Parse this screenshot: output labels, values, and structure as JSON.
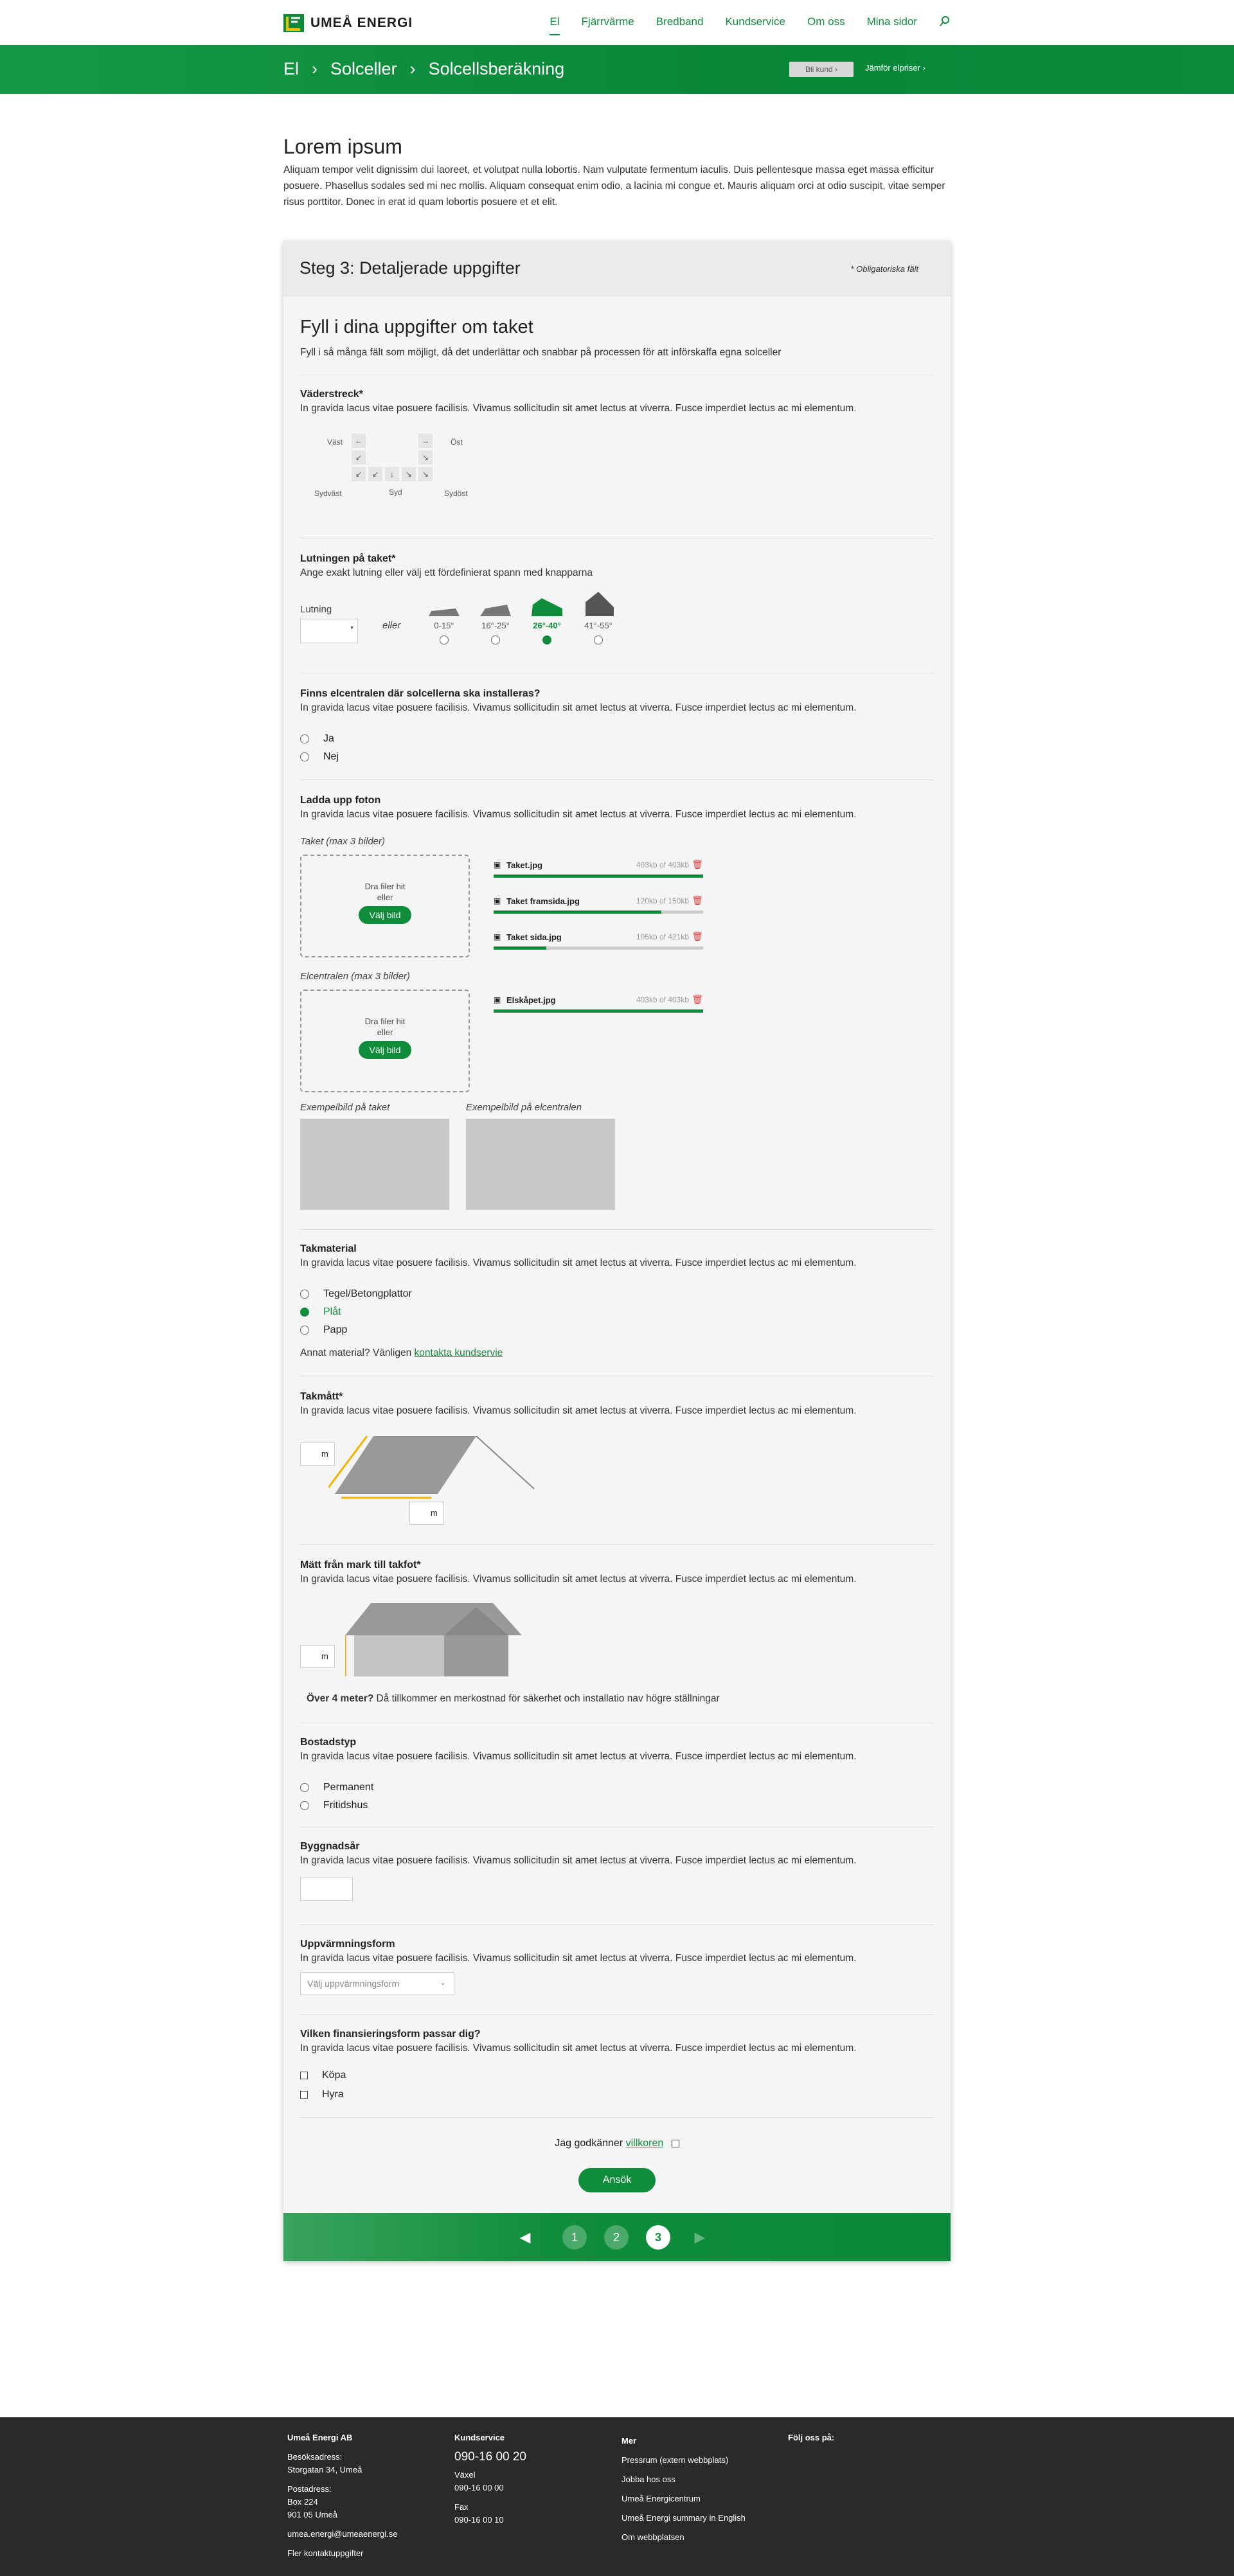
{
  "brand": {
    "name": "UMEÅ ENERGI",
    "colors": {
      "green": "#108d3b",
      "dark_footer": "#2a2a2a",
      "card": "#f5f5f5"
    }
  },
  "topnav": {
    "items": [
      "El",
      "Fjärrvärme",
      "Bredband",
      "Kundservice",
      "Om oss",
      "Mina sidor"
    ],
    "search_icon": "search-icon"
  },
  "band": {
    "crumbs": [
      "El",
      "Solceller",
      "Solcellsberäkning"
    ],
    "customer_btn": "Bli kund ›",
    "compare_link": "Jämför elpriser ›"
  },
  "intro": {
    "title": "Lorem ipsum",
    "text": "Aliquam tempor velit dignissim dui laoreet, et volutpat nulla lobortis. Nam vulputate fermentum iaculis. Duis pellentesque massa eget massa efficitur posuere. Phasellus sodales sed mi nec mollis. Aliquam consequat enim odio, a lacinia mi congue et. Mauris aliquam orci at odio suscipit, vitae semper risus porttitor. Donec in erat id quam lobortis posuere et et elit."
  },
  "card": {
    "title": "Steg 3: Detaljerade uppgifter",
    "required_note": "* Obligatoriska fält"
  },
  "roof": {
    "title": "Fyll i dina uppgifter om taket",
    "subtitle": "Fyll i så många fält som möjligt, då det underlättar och snabbar på processen för att införskaffa egna solceller"
  },
  "lorem": "In gravida lacus vitae posuere facilisis. Vivamus sollicitudin sit amet lectus at viverra. Fusce imperdiet lectus ac mi elementum.",
  "direction": {
    "label": "Väderstreck*",
    "west": "Väst",
    "east": "Öst",
    "southwest": "Sydväst",
    "south": "Syd",
    "southeast": "Sydöst"
  },
  "slope": {
    "label": "Lutningen på taket*",
    "desc": "Ange exakt lutning eller välj ett fördefinierat spann med knapparna",
    "input_label": "Lutning",
    "or": "eller",
    "options": [
      "0-15°",
      "16°-25°",
      "26°-40°",
      "41°-55°"
    ],
    "selected": 2
  },
  "panel": {
    "label": "Finns elcentralen där solcellerna ska installeras?",
    "options": [
      "Ja",
      "Nej"
    ]
  },
  "upload": {
    "label": "Ladda upp foton",
    "roof_caption": "Taket (max 3 bilder)",
    "panel_caption": "Elcentralen (max 3 bilder)",
    "drop_text": "Dra filer hit",
    "or": "eller",
    "choose": "Välj bild",
    "roof_files": [
      {
        "name": "Taket.jpg",
        "size": "403kb of 403kb",
        "progress": 1.0
      },
      {
        "name": "Taket framsida.jpg",
        "size": "120kb of 150kb",
        "progress": 0.8
      },
      {
        "name": "Taket sida.jpg",
        "size": "105kb of 421kb",
        "progress": 0.25
      }
    ],
    "panel_files": [
      {
        "name": "Elskåpet.jpg",
        "size": "403kb of 403kb",
        "progress": 1.0
      }
    ],
    "example_roof": "Exempelbild på taket",
    "example_panel": "Exempelbild på elcentralen"
  },
  "material": {
    "label": "Takmaterial",
    "options": [
      "Tegel/Betongplattor",
      "Plåt",
      "Papp"
    ],
    "selected": 1,
    "other_prefix": "Annat material? Vänligen ",
    "other_link": "kontakta kundservie"
  },
  "size": {
    "label": "Takmått*",
    "unit": "m"
  },
  "height": {
    "label": "Mätt från mark till takfot*",
    "unit": "m",
    "note_bold": "Över 4 meter?",
    "note": " Då tillkommer en merkostnad för säkerhet och installatio nav högre ställningar"
  },
  "housing": {
    "label": "Bostadstyp",
    "options": [
      "Permanent",
      "Fritidshus"
    ]
  },
  "year": {
    "label": "Byggnadsår"
  },
  "heating": {
    "label": "Uppvärmningsform",
    "placeholder": "Välj uppvärmningsform"
  },
  "finance": {
    "label": "Vilken finansieringsform passar dig?",
    "options": [
      "Köpa",
      "Hyra"
    ]
  },
  "terms": {
    "prefix": "Jag godkänner ",
    "link": "villkoren"
  },
  "submit": "Ansök",
  "pager": {
    "pages": [
      "1",
      "2",
      "3"
    ],
    "current": "3"
  },
  "footer": {
    "company": {
      "title": "Umeå Energi AB",
      "visit_label": "Besöksadress:",
      "visit": "Storgatan 34, Umeå",
      "post_label": "Postadress:",
      "post1": "Box 224",
      "post2": "901 05 Umeå",
      "email": "umea.energi@umeaenergi.se",
      "more": "Fler kontaktuppgifter"
    },
    "service": {
      "title": "Kundservice",
      "phone": "090-16 00 20",
      "switch_label": "Växel",
      "switch": "090-16 00 00",
      "fax_label": "Fax",
      "fax": "090-16 00 10"
    },
    "more": {
      "title": "Mer",
      "links": [
        "Pressrum (extern webbplats)",
        "Jobba hos oss",
        "Umeå Energicentrum",
        "Umeå Energi summary in English",
        "Om webbplatsen"
      ]
    },
    "follow": {
      "title": "Följ oss på:"
    }
  }
}
